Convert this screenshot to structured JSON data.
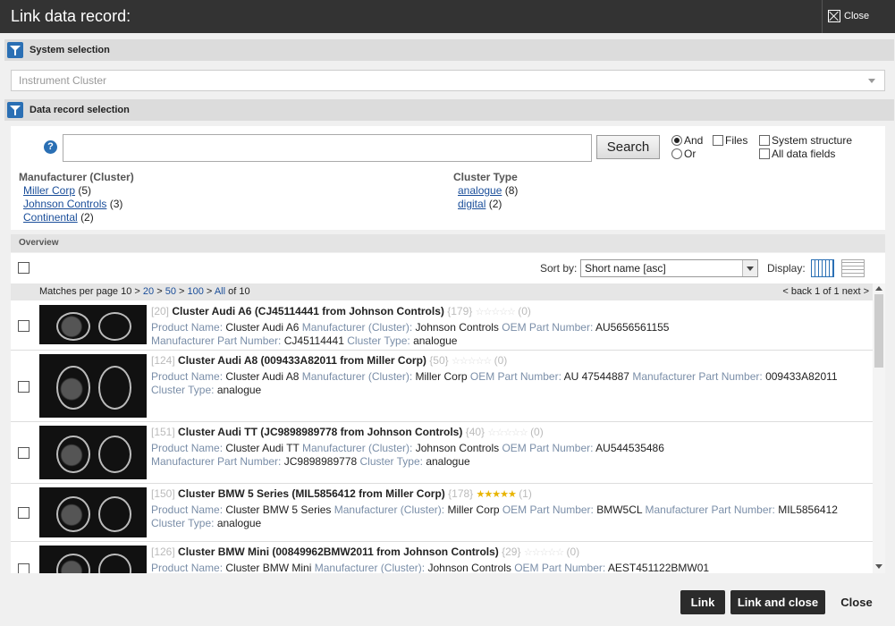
{
  "dialog": {
    "title": "Link data record:",
    "close_label": "Close"
  },
  "system_selection": {
    "header": "System selection",
    "value": "Instrument Cluster"
  },
  "data_record_selection": {
    "header": "Data record selection"
  },
  "search": {
    "help": "?",
    "value": "",
    "button": "Search",
    "options": {
      "and": "And",
      "or": "Or",
      "files": "Files",
      "system_structure": "System structure",
      "all_data_fields": "All data fields"
    }
  },
  "facets": {
    "manufacturer": {
      "title": "Manufacturer (Cluster)",
      "items": [
        {
          "label": "Miller Corp",
          "count": "(5)"
        },
        {
          "label": "Johnson Controls",
          "count": "(3)"
        },
        {
          "label": "Continental",
          "count": "(2)"
        }
      ]
    },
    "cluster_type": {
      "title": "Cluster Type",
      "items": [
        {
          "label": "analogue",
          "count": "(8)"
        },
        {
          "label": "digital",
          "count": "(2)"
        }
      ]
    }
  },
  "overview": {
    "header": "Overview",
    "sort_label": "Sort by:",
    "sort_value": "Short name [asc]",
    "display_label": "Display:",
    "matches_prefix": "Matches per page",
    "page_sizes": [
      "10",
      "20",
      "50",
      "100",
      "All"
    ],
    "of_total": "of 10",
    "pager": {
      "back": "< back",
      "status": "1 of 1",
      "next": "next >"
    }
  },
  "records": [
    {
      "id": "[20]",
      "name": "Cluster Audi A6 (CJ45114441 from Johnson Controls)",
      "count": "{179}",
      "rating": "(0)",
      "stars_gold": false,
      "line1": [
        [
          "Product Name:",
          "Cluster Audi A6"
        ],
        [
          "Manufacturer (Cluster):",
          "Johnson Controls"
        ],
        [
          "OEM Part Number:",
          "AU5656561155"
        ]
      ],
      "line2": [
        [
          "Manufacturer Part Number:",
          "CJ45114441"
        ],
        [
          "Cluster Type:",
          "analogue"
        ]
      ]
    },
    {
      "id": "[124]",
      "name": "Cluster Audi A8 (009433A82011 from Miller Corp)",
      "count": "{50}",
      "rating": "(0)",
      "stars_gold": false,
      "line1": [
        [
          "Product Name:",
          "Cluster Audi A8"
        ],
        [
          "Manufacturer (Cluster):",
          "Miller Corp"
        ],
        [
          "OEM Part Number:",
          "AU 47544887"
        ],
        [
          "Manufacturer Part Number:",
          "009433A82011"
        ]
      ],
      "line2": [
        [
          "Cluster Type:",
          "analogue"
        ]
      ]
    },
    {
      "id": "[151]",
      "name": "Cluster Audi TT (JC9898989778 from Johnson Controls)",
      "count": "{40}",
      "rating": "(0)",
      "stars_gold": false,
      "line1": [
        [
          "Product Name:",
          "Cluster Audi TT"
        ],
        [
          "Manufacturer (Cluster):",
          "Johnson Controls"
        ],
        [
          "OEM Part Number:",
          "AU544535486"
        ]
      ],
      "line2": [
        [
          "Manufacturer Part Number:",
          "JC9898989778"
        ],
        [
          "Cluster Type:",
          "analogue"
        ]
      ]
    },
    {
      "id": "[150]",
      "name": "Cluster BMW 5 Series (MIL5856412 from Miller Corp)",
      "count": "{178}",
      "rating": "(1)",
      "stars_gold": true,
      "line1": [
        [
          "Product Name:",
          "Cluster BMW 5 Series"
        ],
        [
          "Manufacturer (Cluster):",
          "Miller Corp"
        ],
        [
          "OEM Part Number:",
          "BMW5CL"
        ],
        [
          "Manufacturer Part Number:",
          "MIL5856412"
        ]
      ],
      "line2": [
        [
          "Cluster Type:",
          "analogue"
        ]
      ]
    },
    {
      "id": "[126]",
      "name": "Cluster BMW Mini (00849962BMW2011 from Johnson Controls)",
      "count": "{29}",
      "rating": "(0)",
      "stars_gold": false,
      "line1": [
        [
          "Product Name:",
          "Cluster BMW Mini"
        ],
        [
          "Manufacturer (Cluster):",
          "Johnson Controls"
        ],
        [
          "OEM Part Number:",
          "AEST451122BMW01"
        ]
      ],
      "line2": []
    }
  ],
  "footer": {
    "link": "Link",
    "link_close": "Link and close",
    "close": "Close"
  }
}
